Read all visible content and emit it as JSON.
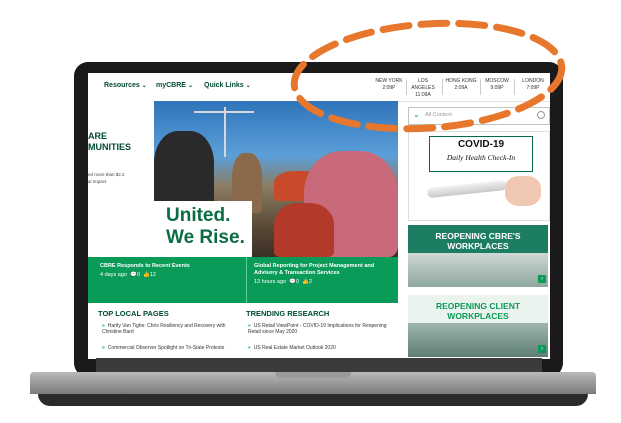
{
  "nav": {
    "items": [
      {
        "label": "Resources"
      },
      {
        "label": "myCBRE"
      },
      {
        "label": "Quick Links"
      }
    ],
    "cities": [
      {
        "name": "NEW YORK",
        "time": "2:09P"
      },
      {
        "name": "LOS ANGELES",
        "time": "11:09A"
      },
      {
        "name": "HONG KONG",
        "time": "2:09A"
      },
      {
        "name": "MOSCOW",
        "time": "9:09P"
      },
      {
        "name": "LONDON",
        "time": "7:09P"
      }
    ]
  },
  "left": {
    "heading": "ARE\nMUNITIES",
    "text": "ed more than $2.2\nal Impact"
  },
  "hero": {
    "line1": "United.",
    "line2": "We Rise."
  },
  "news": [
    {
      "title": "CBRE Responds to Recent Events",
      "age": "4 days ago",
      "comments": "0",
      "likes": "12"
    },
    {
      "title": "Global Reporting for Project Management and Advisory & Transaction Services",
      "age": "13 hours ago",
      "comments": "0",
      "likes": "2"
    }
  ],
  "local_pages": {
    "heading": "TOP LOCAL PAGES",
    "items": [
      "Hartly Van Tighe: Chris Resiliency and Recovery with Christine Bard",
      "Commercial Observer Spotlight on Tri-State Protests"
    ]
  },
  "research": {
    "heading": "TRENDING RESEARCH",
    "items": [
      "US Retail ViewPoint - COVID-19 Implications for Reopening Retail since May 2020",
      "US Real Estate Market Outlook 2020"
    ]
  },
  "search": {
    "placeholder": "All Content"
  },
  "covid": {
    "title": "COVID-19",
    "subtitle": "Daily Health Check-In"
  },
  "tiles": [
    {
      "title": "REOPENING CBRE'S\nWORKPLACES",
      "color": "#ffffff"
    },
    {
      "title": "REOPENING CLIENT\nWORKPLACES",
      "color": "#0a9b59"
    }
  ],
  "colors": {
    "brand_green": "#0a9b59",
    "dark_green": "#004b35",
    "annotation_orange": "#e8772e"
  }
}
